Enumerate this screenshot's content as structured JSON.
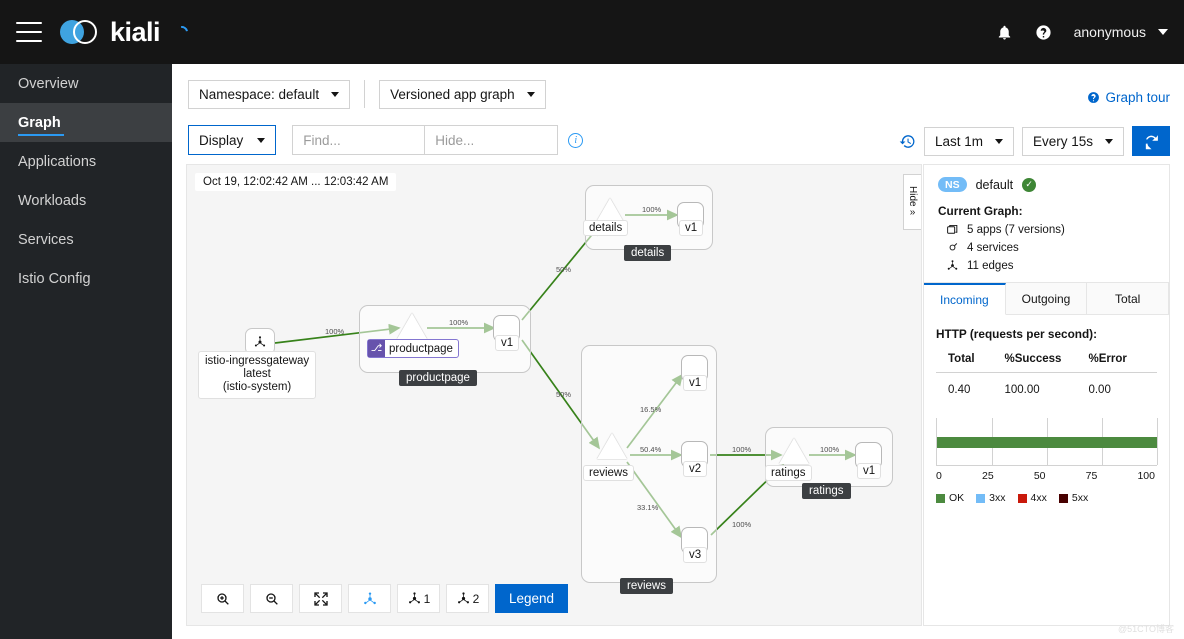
{
  "masthead": {
    "brand": "kiali",
    "menu_icon": "hamburger-icon",
    "notifications_icon": "bell-icon",
    "help_icon": "question-circle-icon",
    "user": "anonymous"
  },
  "sidebar": {
    "items": [
      {
        "label": "Overview",
        "active": false
      },
      {
        "label": "Graph",
        "active": true
      },
      {
        "label": "Applications",
        "active": false
      },
      {
        "label": "Workloads",
        "active": false
      },
      {
        "label": "Services",
        "active": false
      },
      {
        "label": "Istio Config",
        "active": false
      }
    ]
  },
  "toolbar": {
    "namespace_select": "Namespace: default",
    "graph_type_select": "Versioned app graph",
    "graph_tour": "Graph tour",
    "display_button": "Display",
    "find_placeholder": "Find...",
    "hide_placeholder": "Hide...",
    "info_icon": "info-icon",
    "history_icon": "history-icon",
    "duration_select": "Last 1m",
    "refresh_interval_select": "Every 15s",
    "refresh_icon": "refresh-icon"
  },
  "graph": {
    "timestamp": "Oct 19, 12:02:42 AM ... 12:03:42 AM",
    "hide_tab_label": "Hide",
    "hide_tab_chevron": "»",
    "nodes": {
      "ingressgateway": {
        "line1": "istio-ingressgateway",
        "line2": "latest",
        "line3": "(istio-system)"
      },
      "productpage_service": "productpage",
      "productpage_badge": "⎇",
      "productpage_version": "v1",
      "productpage_group": "productpage",
      "details_service": "details",
      "details_version": "v1",
      "details_group": "details",
      "reviews_service": "reviews",
      "reviews_v1": "v1",
      "reviews_v2": "v2",
      "reviews_v3": "v3",
      "reviews_group": "reviews",
      "ratings_service": "ratings",
      "ratings_version": "v1",
      "ratings_group": "ratings"
    },
    "edge_labels": {
      "gw_to_productpage": "100%",
      "productpage_svc_to_v1": "100%",
      "pp_to_details": "50%",
      "pp_to_reviews": "50%",
      "details_svc_to_v1": "100%",
      "reviews_to_v1": "16.5%",
      "reviews_to_v2": "50.4%",
      "reviews_to_v3": "33.1%",
      "v2_to_ratings": "100%",
      "v3_to_ratings": "100%",
      "ratings_svc_to_v1": "100%"
    },
    "bottom_toolbar": {
      "zoom_in": "zoom-in-icon",
      "zoom_out": "zoom-out-icon",
      "fit": "fit-screen-icon",
      "layout_default": "layout-icon",
      "layout_1": "1",
      "layout_2": "2",
      "legend_button": "Legend"
    }
  },
  "side_panel": {
    "ns_badge": "NS",
    "namespace": "default",
    "health_icon": "check-circle-icon",
    "current_graph_title": "Current Graph:",
    "stats": [
      {
        "icon": "apps-icon",
        "text": "5 apps (7 versions)"
      },
      {
        "icon": "services-icon",
        "text": "4 services"
      },
      {
        "icon": "edges-icon",
        "text": "11 edges"
      }
    ],
    "tabs": [
      {
        "label": "Incoming",
        "active": true
      },
      {
        "label": "Outgoing",
        "active": false
      },
      {
        "label": "Total",
        "active": false
      }
    ],
    "http_title": "HTTP (requests per second):",
    "table": {
      "headers": [
        "Total",
        "%Success",
        "%Error"
      ],
      "row": [
        "0.40",
        "100.00",
        "0.00"
      ]
    }
  },
  "chart_data": {
    "type": "bar",
    "title": "HTTP (requests per second):",
    "orientation": "horizontal",
    "categories": [
      "OK"
    ],
    "values": [
      100
    ],
    "xlabel": "",
    "ylabel": "",
    "xlim": [
      0,
      100
    ],
    "ticks": [
      "0",
      "25",
      "50",
      "75",
      "100"
    ],
    "grid": true,
    "legend_position": "bottom",
    "legend": [
      {
        "name": "OK",
        "color": "#4c8a3f",
        "value": 100
      },
      {
        "name": "3xx",
        "color": "#73bcf7",
        "value": 0
      },
      {
        "name": "4xx",
        "color": "#c9190b",
        "value": 0
      },
      {
        "name": "5xx",
        "color": "#470000",
        "value": 0
      }
    ]
  },
  "watermark": "@51CTO博客"
}
